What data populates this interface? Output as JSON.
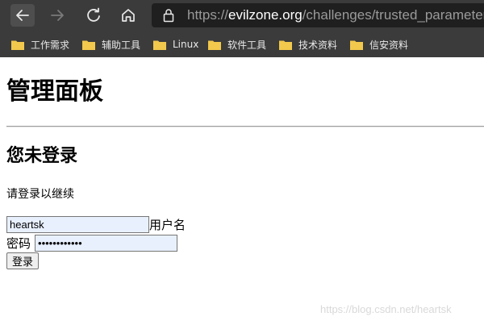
{
  "browser": {
    "url_scheme": "https://",
    "url_host": "evilzone.org",
    "url_path": "/challenges/trusted_parameter/",
    "bookmarks": [
      "工作需求",
      "辅助工具",
      "Linux",
      "软件工具",
      "技术资料",
      "信安资料"
    ]
  },
  "page": {
    "title": "管理面板",
    "subtitle": "您未登录",
    "prompt": "请登录以继续",
    "username_value": "heartsk",
    "username_label": "用户名",
    "password_label": "密码",
    "password_value": "••••••••••••",
    "login_label": "登录"
  },
  "watermark": "https://blog.csdn.net/heartsk",
  "colors": {
    "chrome_bg": "#3b3b3b",
    "address_bg": "#1f1f1f",
    "autofill_bg": "#e8f0fe",
    "folder": "#f2c94c"
  }
}
